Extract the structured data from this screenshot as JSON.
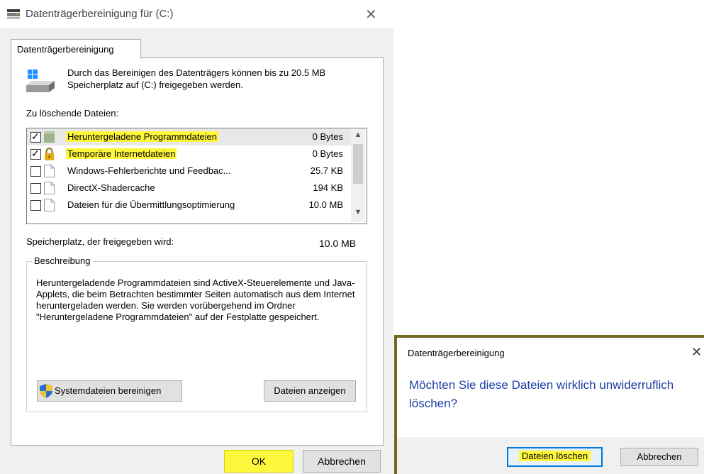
{
  "main_dialog": {
    "title": "Datenträgerbereinigung für  (C:)",
    "close_glyph": "✕",
    "tab_label": "Datenträgerbereinigung",
    "intro_text": "Durch das Bereinigen des Datenträgers können bis zu 20.5 MB Speicherplatz auf  (C:) freigegeben werden.",
    "files_label": "Zu löschende Dateien:",
    "files": [
      {
        "checked": true,
        "icon": "package-icon",
        "name": "Heruntergeladene Programmdateien",
        "size": "0 Bytes",
        "highlighted": true,
        "selected": true
      },
      {
        "checked": true,
        "icon": "lock-icon",
        "name": "Temporäre Internetdateien",
        "size": "0 Bytes",
        "highlighted": true,
        "selected": false
      },
      {
        "checked": false,
        "icon": "document-icon",
        "name": "Windows-Fehlerberichte und Feedbac...",
        "size": "25.7 KB",
        "highlighted": false,
        "selected": false
      },
      {
        "checked": false,
        "icon": "document-icon",
        "name": "DirectX-Shadercache",
        "size": "194 KB",
        "highlighted": false,
        "selected": false
      },
      {
        "checked": false,
        "icon": "document-icon",
        "name": "Dateien für die Übermittlungsoptimierung",
        "size": "10.0 MB",
        "highlighted": false,
        "selected": false
      }
    ],
    "space_label": "Speicherplatz, der freigegeben wird:",
    "space_value": "10.0 MB",
    "description_legend": "Beschreibung",
    "description_text": "Heruntergeladende Programmdateien sind ActiveX-Steuerelemente und Java-Applets, die beim Betrachten bestimmter Seiten automatisch aus dem Internet heruntergeladen werden. Sie werden vorübergehend im Ordner \"Heruntergeladene Programmdateien\" auf der Festplatte gespeichert.",
    "clean_system_label": "Systemdateien bereinigen",
    "show_files_label": "Dateien anzeigen",
    "ok_label": "OK",
    "cancel_label": "Abbrechen"
  },
  "confirm_dialog": {
    "title": "Datenträgerbereinigung",
    "close_glyph": "✕",
    "message": "Möchten Sie diese Dateien wirklich unwiderruflich löschen?",
    "delete_label": "Dateien löschen",
    "cancel_label": "Abbrechen"
  },
  "colors": {
    "highlight": "#fff73b",
    "message_blue": "#1c3fa8",
    "focus_border": "#0078d7",
    "frame": "#6f6a1e"
  }
}
